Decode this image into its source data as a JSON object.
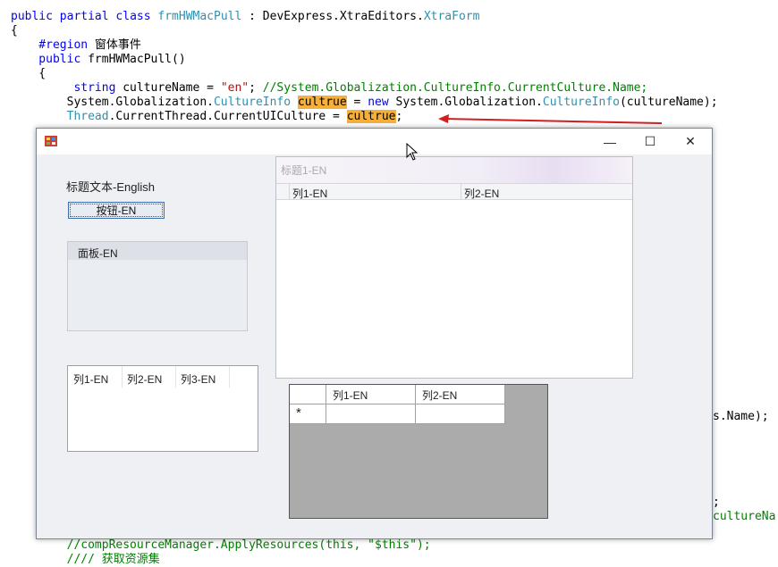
{
  "code_lines": [
    {
      "segs": [
        {
          "t": "public ",
          "c": "kw"
        },
        {
          "t": "partial ",
          "c": "kw"
        },
        {
          "t": "class ",
          "c": "kw"
        },
        {
          "t": "frmHWMacPull",
          "c": "ty"
        },
        {
          "t": " : DevExpress.XtraEditors.",
          "c": ""
        },
        {
          "t": "XtraForm",
          "c": "ty"
        }
      ]
    },
    {
      "segs": [
        {
          "t": "{",
          "c": ""
        }
      ]
    },
    {
      "segs": [
        {
          "t": "    #region ",
          "c": "kw"
        },
        {
          "t": "窗体事件",
          "c": ""
        }
      ]
    },
    {
      "segs": [
        {
          "t": "    public ",
          "c": "kw"
        },
        {
          "t": "frmHWMacPull()",
          "c": ""
        }
      ]
    },
    {
      "segs": [
        {
          "t": "    {",
          "c": ""
        }
      ]
    },
    {
      "segs": [
        {
          "t": "         string ",
          "c": "kw"
        },
        {
          "t": "cultureName = ",
          "c": ""
        },
        {
          "t": "\"en\"",
          "c": "st"
        },
        {
          "t": "; ",
          "c": ""
        },
        {
          "t": "//System.Globalization.CultureInfo.CurrentCulture.Name;",
          "c": "cm"
        }
      ]
    },
    {
      "segs": [
        {
          "t": "        System.Globalization.",
          "c": ""
        },
        {
          "t": "CultureInfo",
          "c": "ty"
        },
        {
          "t": " ",
          "c": ""
        },
        {
          "t": "cultrue",
          "c": "hl"
        },
        {
          "t": " = ",
          "c": ""
        },
        {
          "t": "new ",
          "c": "kw"
        },
        {
          "t": "System.Globalization.",
          "c": ""
        },
        {
          "t": "CultureInfo",
          "c": "ty"
        },
        {
          "t": "(cultureName);",
          "c": ""
        }
      ]
    },
    {
      "segs": [
        {
          "t": "        ",
          "c": ""
        },
        {
          "t": "Thread",
          "c": "ty"
        },
        {
          "t": ".CurrentThread.CurrentUICulture = ",
          "c": ""
        },
        {
          "t": "cultrue",
          "c": "hl"
        },
        {
          "t": ";",
          "c": ""
        }
      ]
    }
  ],
  "code_fragments": {
    "name_tail": "s.Name);",
    "semicolon": ";",
    "culture_tail": "cultureNa",
    "bottom_line1": "        //compResourceManager.ApplyResources(this, \"$this\");",
    "bottom_line2": "        //// 获取资源集"
  },
  "window": {
    "title": "",
    "minimize": "—",
    "maximize": "☐",
    "close": "✕"
  },
  "form": {
    "label_text": "标题文本-English",
    "button_text": "按钮-EN",
    "panel_caption": "面板-EN",
    "listview_columns": [
      "列1-EN",
      "列2-EN",
      "列3-EN"
    ],
    "group_caption": "标题1-EN",
    "grid_columns": [
      "列1-EN",
      "列2-EN"
    ],
    "datagrid_columns": [
      "列1-EN",
      "列2-EN"
    ],
    "new_row_marker": "*"
  },
  "colors": {
    "keyword": "#0000ff",
    "type": "#2b91af",
    "string": "#a31515",
    "comment": "#008000",
    "highlight": "#f5b03c",
    "arrow": "#d21f1f"
  }
}
